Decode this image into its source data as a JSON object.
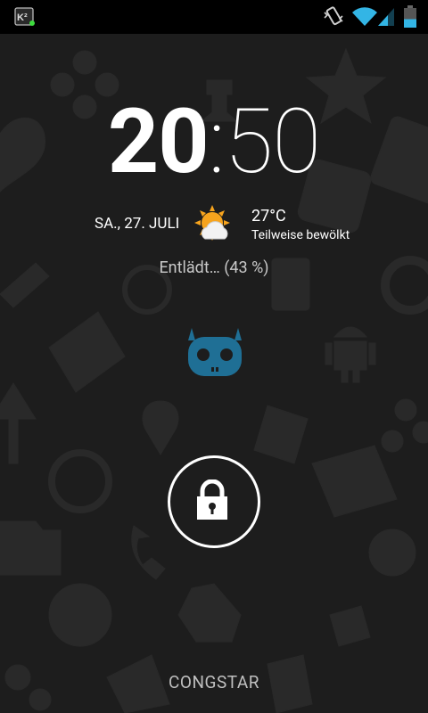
{
  "status_bar": {
    "notification_app": "K²",
    "icons": [
      "k2-notification-icon",
      "vibrate-icon",
      "wifi-icon",
      "signal-icon",
      "battery-icon"
    ]
  },
  "lockscreen": {
    "clock": {
      "hours": "20",
      "separator": ":",
      "minutes": "50"
    },
    "date": "SA., 27. JULI",
    "weather": {
      "icon": "partly-cloudy-icon",
      "temperature": "27°C",
      "condition": "Teilweise bewölkt"
    },
    "battery_status": "Entlädt… (43 %)",
    "battery_level": 0.43,
    "mascot": "cyanogenmod-cid-icon",
    "unlock_icon": "padlock-icon",
    "carrier": "CONGSTAR"
  },
  "colors": {
    "background": "#1d1d1d",
    "status_bar": "#000000",
    "accent": "#33b5e5",
    "mascot": "#1f6f95",
    "pattern": "#2b2b2b"
  }
}
